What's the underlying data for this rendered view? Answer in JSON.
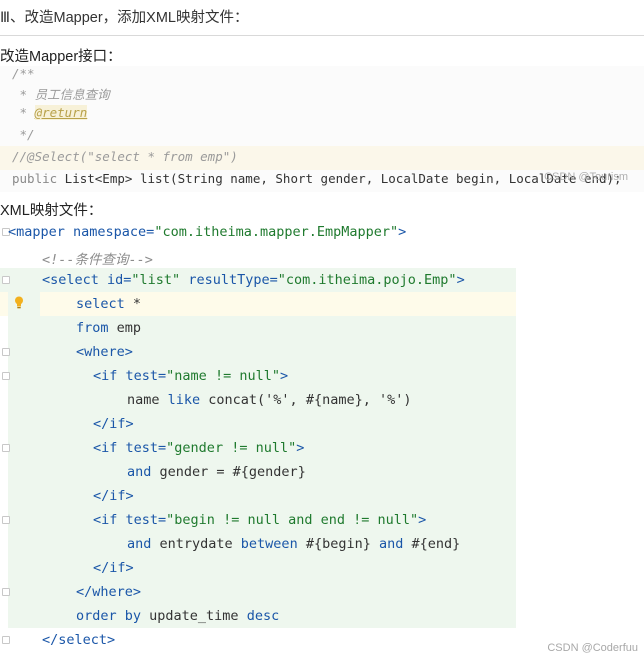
{
  "heading": "Ⅲ、改造Mapper，添加XML映射文件：",
  "mapper_label": "改造Mapper接口：",
  "xml_label": "XML映射文件：",
  "java_code": {
    "line1": "/**",
    "line2": " * 员工信息查询",
    "line3_prefix": " * ",
    "line3_tag": "@return",
    "line4": " */",
    "line5": "//@Select(\"select * from emp\")",
    "line6_kw": "public",
    "line6_rest": " List<Emp> list(String name, Short gender, LocalDate begin, LocalDate end);"
  },
  "xml_code": {
    "l1_tag": "<mapper",
    "l1_attr": " namespace=",
    "l1_val": "\"com.itheima.mapper.EmpMapper\"",
    "l1_end": ">",
    "l2_comment": "<!--条件查询-->",
    "l3_tag": "<select",
    "l3_attr1": " id=",
    "l3_val1": "\"list\"",
    "l3_attr2": " resultType=",
    "l3_val2": "\"com.itheima.pojo.Emp\"",
    "l3_end": ">",
    "l4_kw": "select",
    "l4_rest": " *",
    "l5_kw": "from",
    "l5_rest": " emp",
    "l6": "<where>",
    "l7_tag": "<if",
    "l7_attr": " test=",
    "l7_val": "\"name != null\"",
    "l7_end": ">",
    "l8_a": "name ",
    "l8_kw": "like",
    "l8_b": " concat('%', #{name}, '%')",
    "l9": "</if>",
    "l10_tag": "<if",
    "l10_attr": " test=",
    "l10_val": "\"gender != null\"",
    "l10_end": ">",
    "l11_kw": "and",
    "l11_rest": " gender = #{gender}",
    "l12": "</if>",
    "l13_tag": "<if",
    "l13_attr": " test=",
    "l13_val": "\"begin != null and end != null\"",
    "l13_end": ">",
    "l14_kw1": "and",
    "l14_a": " entrydate ",
    "l14_kw2": "between",
    "l14_b": " #{begin} ",
    "l14_kw3": "and",
    "l14_c": " #{end}",
    "l15": "</if>",
    "l16": "</where>",
    "l17_kw1": "order by",
    "l17_a": " update_time ",
    "l17_kw2": "desc",
    "l18": "</select>"
  },
  "watermark_inline": "CSDN @Tourism",
  "watermark_bottom": "CSDN @Coderfuu"
}
